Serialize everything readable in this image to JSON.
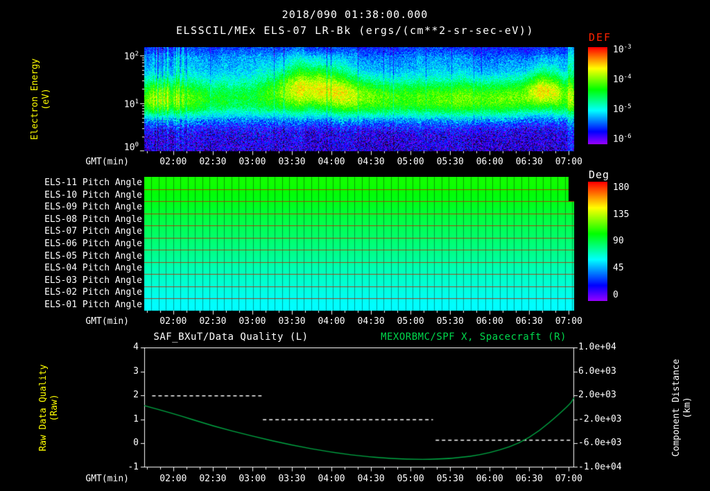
{
  "page": {
    "bg": "#000000",
    "title": "2018/090 01:38:00.000",
    "subtitle": "ELSSCIL/MEx ELS-07 LR-Bk (ergs/(cm**2-sr-sec-eV))"
  },
  "time_axis": {
    "label": "GMT(min)",
    "duration_min": 326,
    "ticks": [
      {
        "label": "02:00",
        "t": 22
      },
      {
        "label": "02:30",
        "t": 52
      },
      {
        "label": "03:00",
        "t": 82
      },
      {
        "label": "03:30",
        "t": 112
      },
      {
        "label": "04:00",
        "t": 142
      },
      {
        "label": "04:30",
        "t": 172
      },
      {
        "label": "05:00",
        "t": 202
      },
      {
        "label": "05:30",
        "t": 232
      },
      {
        "label": "06:00",
        "t": 262
      },
      {
        "label": "06:30",
        "t": 292
      },
      {
        "label": "07:00",
        "t": 322
      }
    ]
  },
  "chart_data": [
    {
      "type": "heatmap",
      "name": "electron-energy-spectrogram",
      "title": "ELSSCIL/MEx ELS-07 LR-Bk",
      "units": "ergs/(cm**2-sr-sec-eV)",
      "ylabel": "Electron Energy\n(eV)",
      "ylabel_color": "#ffff00",
      "yscale": "log",
      "ylim": [
        1,
        148
      ],
      "yticks": [
        {
          "base": "10",
          "exp": "2"
        },
        {
          "base": "10",
          "exp": "1"
        },
        {
          "base": "10",
          "exp": "0"
        }
      ],
      "colorbar": {
        "label": "DEF",
        "label_color": "#ff2200",
        "scale": "log",
        "lim": [
          1e-06,
          0.001
        ],
        "ticks": [
          {
            "base": "10",
            "exp": "-3"
          },
          {
            "base": "10",
            "exp": "-4"
          },
          {
            "base": "10",
            "exp": "-5"
          },
          {
            "base": "10",
            "exp": "-6"
          }
        ]
      },
      "visual_summary": "Bright green flux band between ~7 and 45 eV centered near 14 eV across all times; yellow enhancements near 03:30-04:10, 06:30-06:50 and at the right edge; vertical bright/dark streaks near 01:45-02:10; blue/cyan speckled background above the band (~1e-5.2); dark purple/black noise below ~5 eV (~1e-5.8)"
    },
    {
      "type": "heatmap",
      "name": "pitch-angle-panels",
      "rows": [
        {
          "label": "ELS-11 Pitch Angle",
          "mean_deg": 104
        },
        {
          "label": "ELS-10 Pitch Angle",
          "mean_deg": 100
        },
        {
          "label": "ELS-09 Pitch Angle",
          "mean_deg": 96
        },
        {
          "label": "ELS-08 Pitch Angle",
          "mean_deg": 91
        },
        {
          "label": "ELS-07 Pitch Angle",
          "mean_deg": 87
        },
        {
          "label": "ELS-06 Pitch Angle",
          "mean_deg": 83
        },
        {
          "label": "ELS-05 Pitch Angle",
          "mean_deg": 79
        },
        {
          "label": "ELS-04 Pitch Angle",
          "mean_deg": 74
        },
        {
          "label": "ELS-03 Pitch Angle",
          "mean_deg": 70
        },
        {
          "label": "ELS-02 Pitch Angle",
          "mean_deg": 66
        },
        {
          "label": "ELS-01 Pitch Angle",
          "mean_deg": 62
        }
      ],
      "colorbar": {
        "label": "Deg",
        "label_color": "#ffffff",
        "lim": [
          0,
          180
        ],
        "ticks": [
          {
            "label": "180",
            "value": 180
          },
          {
            "label": "135",
            "value": 135
          },
          {
            "label": "90",
            "value": 90
          },
          {
            "label": "45",
            "value": 45
          },
          {
            "label": "0",
            "value": 0
          }
        ]
      },
      "visual_summary": "Eleven anode rows forming a smooth green-to-cyan gradient (~105 deg at top to ~60 deg at bottom), thin red row separators, dark vertical record boundaries every ~5.5 min, black data gap at top right"
    },
    {
      "type": "line",
      "name": "quality-and-distance",
      "left_axis": {
        "title": "SAF_BXuT/Data Quality (L)",
        "title_color": "#ffffff",
        "ylabel": "Raw Data Quality\n(Raw)",
        "ylabel_color": "#ffff00",
        "ylim": [
          -1,
          4
        ],
        "yticks": [
          {
            "label": "4",
            "value": 4
          },
          {
            "label": "3",
            "value": 3
          },
          {
            "label": "2",
            "value": 2
          },
          {
            "label": "1",
            "value": 1
          },
          {
            "label": "0",
            "value": 0
          },
          {
            "label": "-1",
            "value": -1
          }
        ]
      },
      "right_axis": {
        "title": "MEXORBMC/SPF X, Spacecraft (R)",
        "title_color": "#00d84c",
        "ylabel": "Component Distance\n(km)",
        "ylabel_color": "#ffffff",
        "ylim": [
          -10000,
          10000
        ],
        "yticks": [
          {
            "label": "1.0e+04",
            "value": 10000
          },
          {
            "label": "6.0e+03",
            "value": 6000
          },
          {
            "label": "2.0e+03",
            "value": 2000
          },
          {
            "label": "-2.0e+03",
            "value": -2000
          },
          {
            "label": "-6.0e+03",
            "value": -6000
          },
          {
            "label": "-1.0e+04",
            "value": -10000
          }
        ]
      },
      "series": [
        {
          "name": "SAF_BXuT/Data Quality",
          "axis": "left",
          "style": "dashed",
          "color": "#ffffff",
          "segments": [
            {
              "value": 2,
              "t0": 6,
              "t1": 89
            },
            {
              "value": 1,
              "t0": 90,
              "t1": 219
            },
            {
              "value": 0.15,
              "t0": 221,
              "t1": 325
            }
          ]
        },
        {
          "name": "MEXORBMC/SPF X Spacecraft",
          "axis": "right",
          "style": "solid",
          "color": "#00a844",
          "points_t": [
            0,
            22,
            52,
            82,
            112,
            142,
            172,
            202,
            232,
            262,
            292,
            322,
            326
          ],
          "points_km": [
            300,
            -1000,
            -3100,
            -4800,
            -6300,
            -7500,
            -8300,
            -8700,
            -8600,
            -7700,
            -5400,
            300,
            1600
          ]
        }
      ]
    }
  ]
}
